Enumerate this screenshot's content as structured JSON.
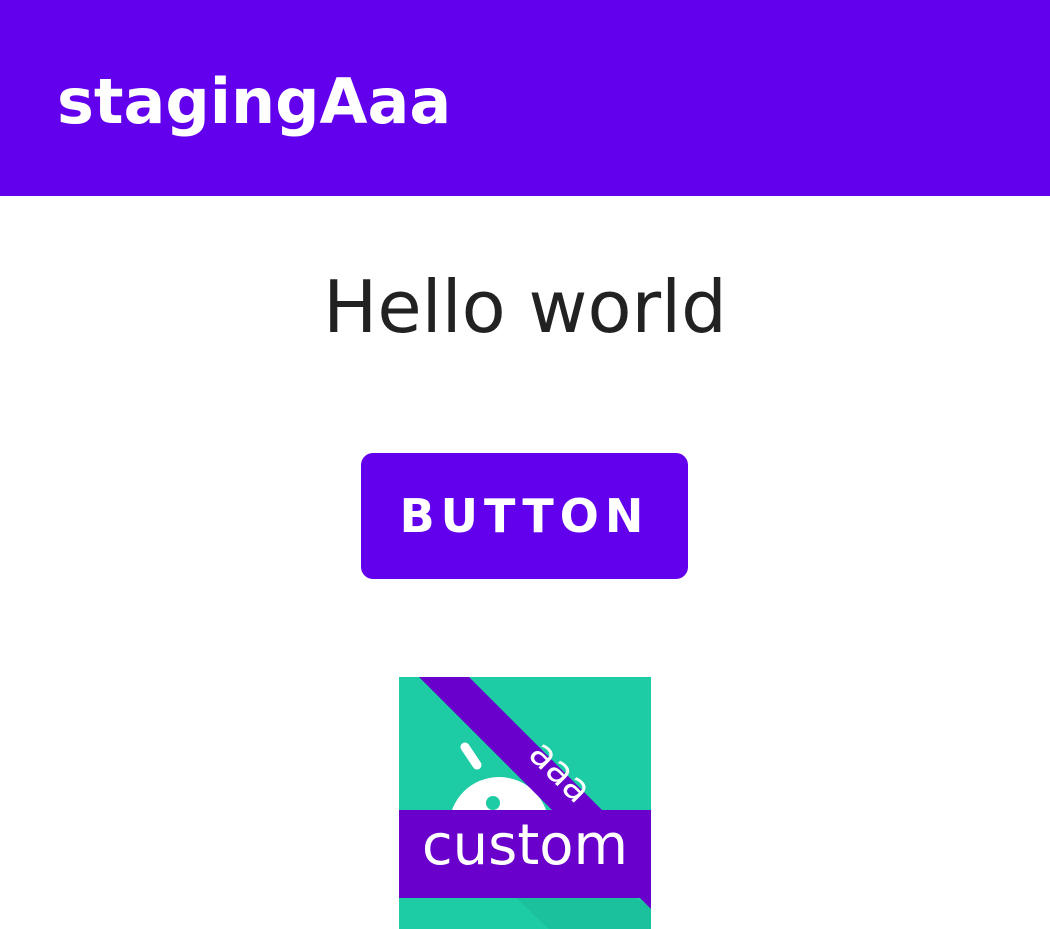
{
  "app_bar": {
    "title": "stagingAaa"
  },
  "main": {
    "greeting": "Hello world",
    "button_label": "BUTTON"
  },
  "app_icon": {
    "name": "android-launcher-icon",
    "ribbon_text": "aaa",
    "banner_text": "custom"
  },
  "colors": {
    "primary": "#6200EE",
    "icon_background": "#1DCBA5",
    "icon_ribbon": "#6A00CC",
    "text_primary": "#222222",
    "on_primary": "#FFFFFF"
  }
}
